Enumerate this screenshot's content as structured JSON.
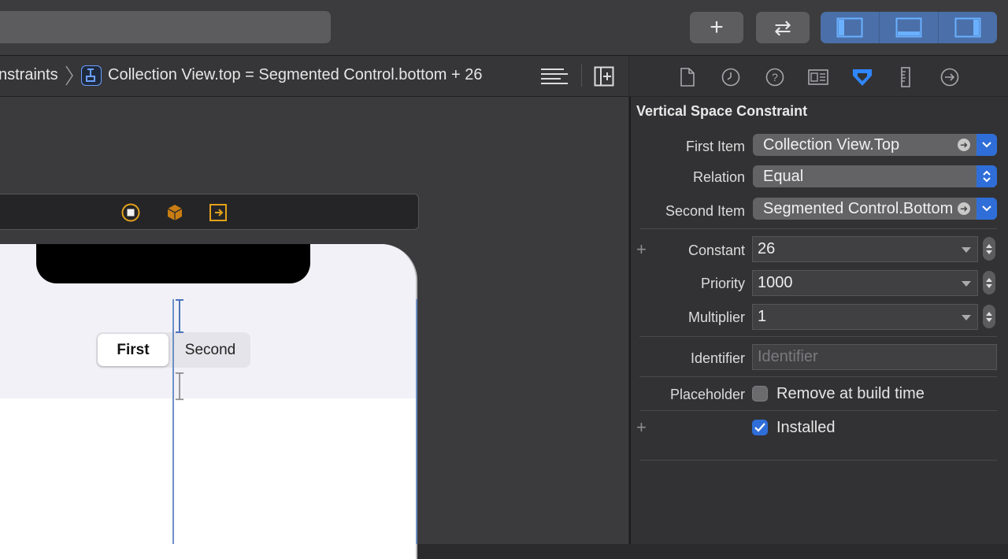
{
  "toolbar": {
    "add_button": "+",
    "swap_button": "⇄"
  },
  "jumpbar": {
    "crumb_constraints": "nstraints",
    "crumb_current": "Collection View.top = Segmented Control.bottom + 26"
  },
  "canvas": {
    "segmented": {
      "first": "First",
      "second": "Second"
    }
  },
  "inspector": {
    "title": "Vertical Space Constraint",
    "first_item_label": "First Item",
    "first_item_value": "Collection View.Top",
    "relation_label": "Relation",
    "relation_value": "Equal",
    "second_item_label": "Second Item",
    "second_item_value": "Segmented Control.Bottom",
    "constant_label": "Constant",
    "constant_value": "26",
    "priority_label": "Priority",
    "priority_value": "1000",
    "multiplier_label": "Multiplier",
    "multiplier_value": "1",
    "identifier_label": "Identifier",
    "identifier_placeholder": "Identifier",
    "placeholder_label": "Placeholder",
    "remove_at_build_time": "Remove at build time",
    "installed_label": "Installed",
    "plus": "+"
  },
  "colors": {
    "accent": "#2f6ed8",
    "constraint_line": "#6d8fc6",
    "scene_icon": "#e3a21a"
  }
}
